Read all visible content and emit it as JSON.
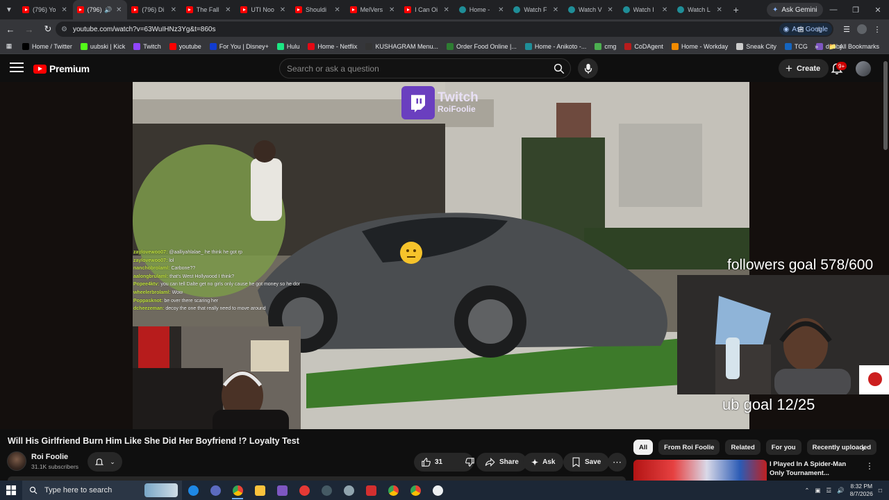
{
  "browser": {
    "tabs": [
      {
        "label": "(796) Yo",
        "icon": "youtube",
        "active": false
      },
      {
        "label": "(796)",
        "icon": "youtube",
        "active": true,
        "audio": true
      },
      {
        "label": "(796) Di",
        "icon": "youtube",
        "active": false
      },
      {
        "label": "The Fall",
        "icon": "youtube",
        "active": false
      },
      {
        "label": "UTI Noo",
        "icon": "youtube",
        "active": false
      },
      {
        "label": "Shouldi",
        "icon": "youtube",
        "active": false
      },
      {
        "label": "MelVers",
        "icon": "youtube",
        "active": false
      },
      {
        "label": "I Can Oi",
        "icon": "youtube",
        "active": false
      },
      {
        "label": "Home -",
        "icon": "globe",
        "active": false
      },
      {
        "label": "Watch F",
        "icon": "globe",
        "active": false
      },
      {
        "label": "Watch V",
        "icon": "globe",
        "active": false
      },
      {
        "label": "Watch I",
        "icon": "globe",
        "active": false
      },
      {
        "label": "Watch L",
        "icon": "globe",
        "active": false
      }
    ],
    "ask_gemini": "Ask Gemini",
    "url": "youtube.com/watch?v=63WuIHNz3Yg&t=860s",
    "ask_google": "Ask Google",
    "bookmarks": [
      {
        "label": "Home / Twitter",
        "color": "#000000"
      },
      {
        "label": "uubski | Kick",
        "color": "#53fc18"
      },
      {
        "label": "Twitch",
        "color": "#9146ff"
      },
      {
        "label": "youtube",
        "color": "#ff0000"
      },
      {
        "label": "For You | Disney+",
        "color": "#113ccf"
      },
      {
        "label": "Hulu",
        "color": "#1ce783"
      },
      {
        "label": "Home - Netflix",
        "color": "#e50914"
      },
      {
        "label": "KUSHAGRAM Menu...",
        "color": "#333333"
      },
      {
        "label": "Order Food Online |...",
        "color": "#2e7d32"
      },
      {
        "label": "Home - Anikoto -...",
        "color": "#1f8e98"
      },
      {
        "label": "cmg",
        "color": "#4caf50"
      },
      {
        "label": "CoDAgent",
        "color": "#b71c1c"
      },
      {
        "label": "Home - Workday",
        "color": "#f38b00"
      },
      {
        "label": "Sneak City",
        "color": "#cccccc"
      },
      {
        "label": "TCG",
        "color": "#1565c0"
      },
      {
        "label": "dubby",
        "color": "#7e57c2"
      }
    ],
    "all_bookmarks": "All Bookmarks"
  },
  "youtube": {
    "logo_text": "Premium",
    "search_placeholder": "Search or ask a question",
    "create_label": "Create",
    "notification_badge": "9+"
  },
  "video": {
    "title": "Will His Girlfriend Burn Him Like She Did Her Boyfriend !? Loyalty Test",
    "channel": "Roi Foolie",
    "subscribers": "31.1K subscribers",
    "likes": "31",
    "share_label": "Share",
    "ask_label": "Ask",
    "save_label": "Save"
  },
  "stream_overlay": {
    "followers_goal": "followers goal 578/600",
    "sub_goal": "ub goal 12/25",
    "twitch_brand": "Twitch",
    "twitch_user": "RoiFoolie",
    "chat": [
      {
        "user": "zaylovewoo07:",
        "msg": "@aalliyahlalae_ he think he got rp"
      },
      {
        "user": "zaylovewoo07:",
        "msg": "lol"
      },
      {
        "user": "nanchobrolaml:",
        "msg": "Carbone??"
      },
      {
        "user": "aalongbrulaml:",
        "msg": "that's West Hollywood I think?"
      },
      {
        "user": "Popee4ktv:",
        "msg": "you can tell Dalte get no girls only cause he got money so he dont know how to play ball"
      },
      {
        "user": "wheelerbrolaml:",
        "msg": "Wow"
      },
      {
        "user": "Poppasknot:",
        "msg": "be over there scaring her"
      },
      {
        "user": "dcheezeman:",
        "msg": "decoy the one that really need to move around"
      }
    ]
  },
  "sidebar_chips": [
    "All",
    "From Roi Foolie",
    "Related",
    "For you",
    "Recently uploaded"
  ],
  "recommended": {
    "title": "I Played In A Spider-Man Only Tournament..."
  },
  "taskbar": {
    "search_placeholder": "Type here to search",
    "time": "8:32 PM",
    "date": "8/7/2026"
  }
}
